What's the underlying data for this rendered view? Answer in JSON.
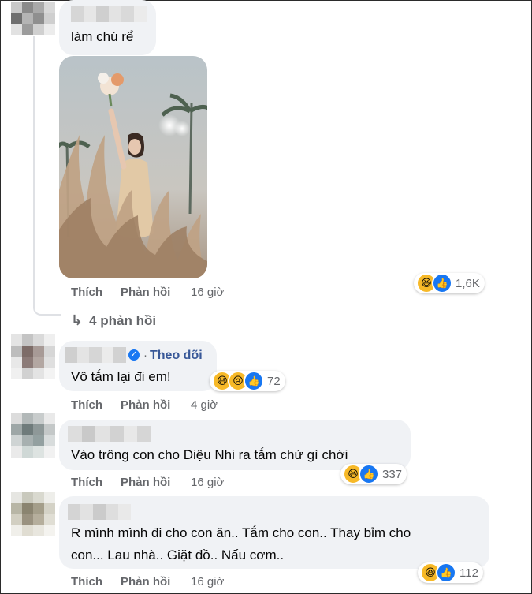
{
  "colors": {
    "bubble_bg": "#f0f2f5",
    "secondary_text": "#65676b",
    "link_blue": "#385898",
    "like_blue": "#1877f2",
    "haha_yellow": "#f7b928"
  },
  "comments": [
    {
      "text": "làm chú rể",
      "has_image": true,
      "image_alt": "Bride holding bouquet among pampas grass",
      "actions": {
        "like": "Thích",
        "reply": "Phản hồi",
        "time": "16 giờ"
      },
      "reactions": {
        "icons": [
          "haha-icon",
          "like-icon"
        ],
        "count": "1,6K"
      },
      "replies_link": "4 phản hồi"
    },
    {
      "follow": "Theo dõi",
      "text": "Vô tắm lại đi em!",
      "actions": {
        "like": "Thích",
        "reply": "Phản hồi",
        "time": "4 giờ"
      },
      "reactions": {
        "icons": [
          "haha-icon",
          "sad-icon",
          "like-icon"
        ],
        "count": "72"
      }
    },
    {
      "text": "Vào trông con cho Diệu Nhi ra tắm chứ gì chời",
      "actions": {
        "like": "Thích",
        "reply": "Phản hồi",
        "time": "16 giờ"
      },
      "reactions": {
        "icons": [
          "haha-icon",
          "like-icon"
        ],
        "count": "337"
      }
    },
    {
      "text_line1": "R mình mình đi cho con ăn.. Tắm cho con.. Thay bỉm cho",
      "text_line2": "con... Lau nhà.. Giặt đồ.. Nấu cơm..",
      "actions": {
        "like": "Thích",
        "reply": "Phản hồi",
        "time": "16 giờ"
      },
      "reactions": {
        "icons": [
          "haha-icon",
          "like-icon"
        ],
        "count": "112"
      }
    }
  ]
}
